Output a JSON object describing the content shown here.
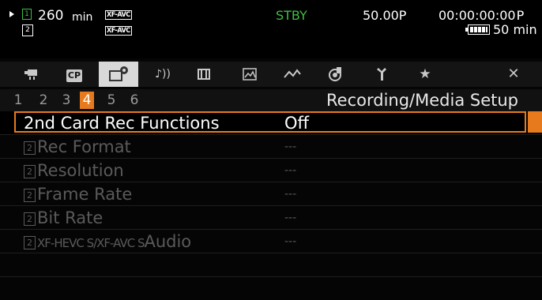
{
  "status_bar": {
    "slot_number": "1",
    "remaining": "260",
    "remaining_unit": "min",
    "format_badge_top": "XF-AVC",
    "format_badge_bottom": "XF-AVC",
    "slot2_label": "2",
    "mode": "STBY",
    "frame_rate": "50.00P",
    "timecode": "00:00:00:00",
    "timecode_suffix": "P",
    "battery_time": "50 min",
    "mode_color": "#3fbf3f"
  },
  "tabs": [
    {
      "icon": "camera-icon"
    },
    {
      "icon": "custom-picture-icon",
      "label": "CP"
    },
    {
      "icon": "recording-setup-icon"
    },
    {
      "icon": "audio-icon",
      "label": "♪))"
    },
    {
      "icon": "monitor-icon"
    },
    {
      "icon": "assist-icon"
    },
    {
      "icon": "network-icon"
    },
    {
      "icon": "system-icon"
    },
    {
      "icon": "maintenance-icon"
    },
    {
      "icon": "my-menu-icon",
      "label": "★"
    },
    {
      "icon": "close-icon",
      "label": "✕"
    }
  ],
  "pages": [
    "1",
    "2",
    "3",
    "4",
    "5",
    "6"
  ],
  "active_page": "4",
  "page_title": "Recording/Media Setup",
  "menu_items": [
    {
      "label": "2nd Card Rec Functions",
      "value": "Off"
    },
    {
      "prefix": "2",
      "label": "Rec Format",
      "value": "---"
    },
    {
      "prefix": "2",
      "label": "Resolution",
      "value": "---"
    },
    {
      "prefix": "2",
      "label": "Frame Rate",
      "value": "---"
    },
    {
      "prefix": "2",
      "label": "Bit Rate",
      "value": "---"
    },
    {
      "prefix": "2",
      "label_small": "XF-HEVC S/XF-AVC S",
      "label": "Audio",
      "value": "---"
    }
  ],
  "accent_color": "#e87a1e"
}
